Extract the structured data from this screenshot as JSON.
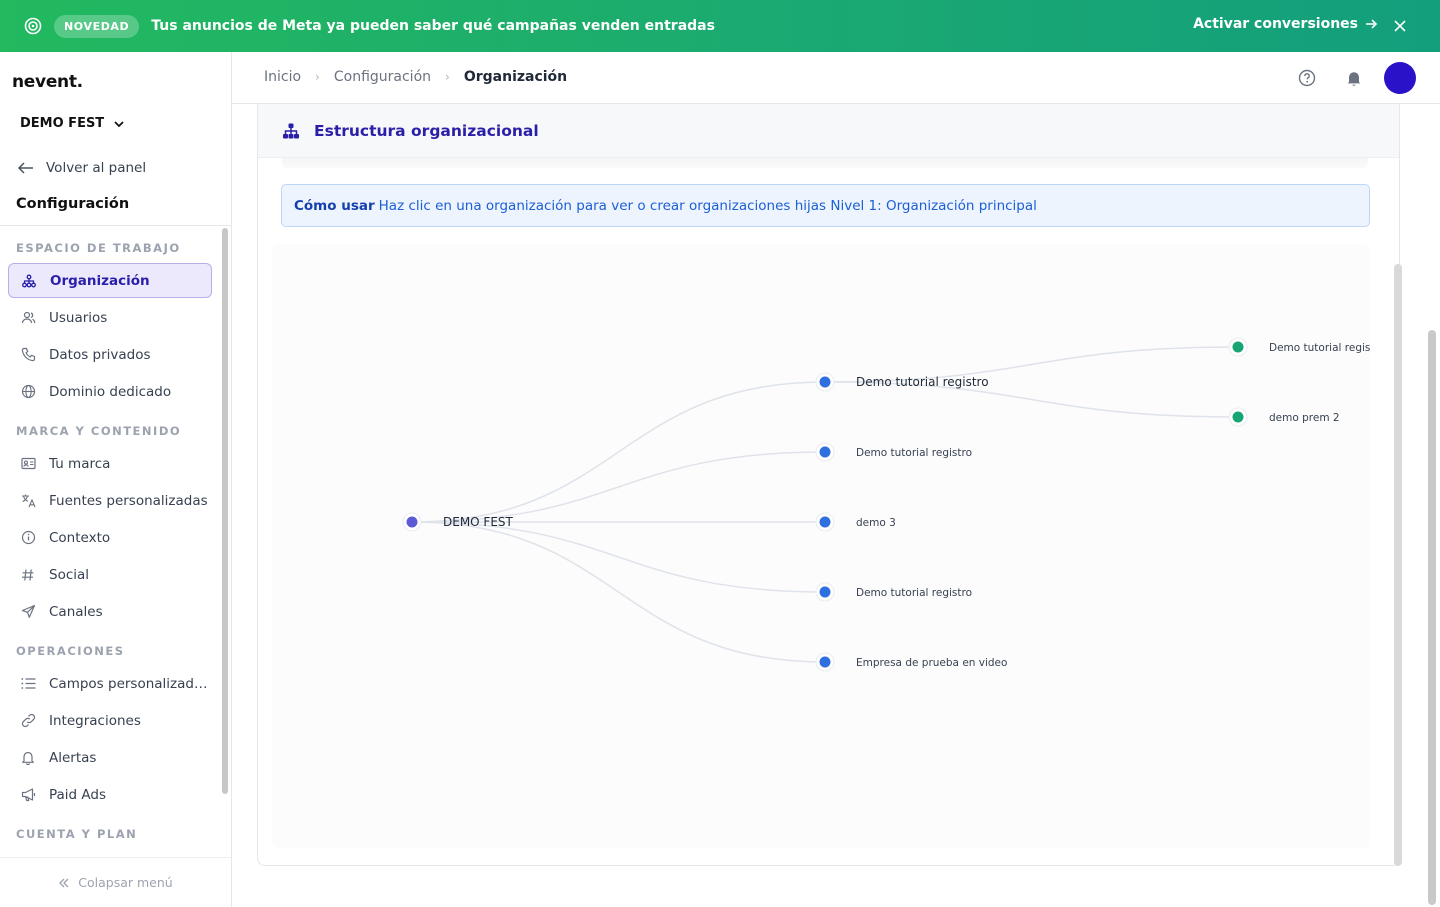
{
  "banner": {
    "badge": "NOVEDAD",
    "message": "Tus anuncios de Meta ya pueden saber qué campañas venden entradas",
    "cta": "Activar conversiones",
    "icon": "target-icon",
    "color": "#1aa873"
  },
  "sidebar": {
    "logo": "nevent.",
    "org_selector": "DEMO FEST",
    "back_label": "Volver al panel",
    "section_title": "Configuración",
    "groups": [
      {
        "title": "ESPACIO DE TRABAJO",
        "items": [
          {
            "label": "Organización",
            "icon": "hierarchy-icon",
            "active": true
          },
          {
            "label": "Usuarios",
            "icon": "users-icon"
          },
          {
            "label": "Datos privados",
            "icon": "phone-icon"
          },
          {
            "label": "Dominio dedicado",
            "icon": "globe-icon"
          }
        ]
      },
      {
        "title": "MARCA Y CONTENIDO",
        "items": [
          {
            "label": "Tu marca",
            "icon": "id-card-icon"
          },
          {
            "label": "Fuentes personalizadas",
            "icon": "translate-icon"
          },
          {
            "label": "Contexto",
            "icon": "info-icon"
          },
          {
            "label": "Social",
            "icon": "hashtag-icon"
          },
          {
            "label": "Canales",
            "icon": "send-icon"
          }
        ]
      },
      {
        "title": "OPERACIONES",
        "items": [
          {
            "label": "Campos personalizados",
            "icon": "list-icon"
          },
          {
            "label": "Integraciones",
            "icon": "link-icon"
          },
          {
            "label": "Alertas",
            "icon": "bell-icon"
          },
          {
            "label": "Paid Ads",
            "icon": "megaphone-icon"
          }
        ]
      },
      {
        "title": "CUENTA Y PLAN",
        "items": []
      }
    ],
    "collapse_label": "Colapsar menú",
    "active_color": "#2a1fa8"
  },
  "header": {
    "breadcrumb": [
      "Inicio",
      "Configuración",
      "Organización"
    ],
    "avatar_color": "#2a12c8"
  },
  "card": {
    "title": "Estructura organizacional",
    "info_strong": "Cómo usar",
    "info_text": "Haz clic en una organización para ver o crear organizaciones hijas Nivel 1: Organización principal"
  },
  "tree": {
    "root": {
      "label": "DEMO FEST",
      "color": "#5b5bd6"
    },
    "level1": [
      {
        "label": "Demo tutorial registro",
        "color": "#2f6fde"
      },
      {
        "label": "Demo tutorial registro",
        "color": "#2f6fde"
      },
      {
        "label": "demo 3",
        "color": "#2f6fde"
      },
      {
        "label": "Demo tutorial registro",
        "color": "#2f6fde"
      },
      {
        "label": "Empresa de prueba en video",
        "color": "#2f6fde"
      }
    ],
    "level2": [
      {
        "label": "Demo tutorial registro",
        "parent": 0,
        "color": "#17a673"
      },
      {
        "label": "demo prem 2",
        "parent": 0,
        "color": "#17a673"
      }
    ]
  }
}
